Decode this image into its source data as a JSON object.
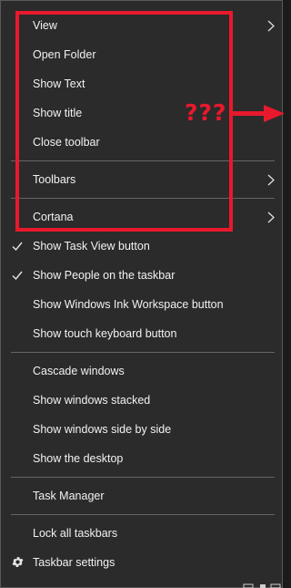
{
  "menu": {
    "view": "View",
    "open_folder": "Open Folder",
    "show_text": "Show Text",
    "show_title": "Show title",
    "close_toolbar": "Close toolbar",
    "toolbars": "Toolbars",
    "cortana": "Cortana",
    "show_task_view": "Show Task View button",
    "show_people": "Show People on the taskbar",
    "show_ink": "Show Windows Ink Workspace button",
    "show_touch_keyboard": "Show touch keyboard button",
    "cascade": "Cascade windows",
    "stacked": "Show windows stacked",
    "side_by_side": "Show windows side by side",
    "show_desktop": "Show the desktop",
    "task_manager": "Task Manager",
    "lock_taskbars": "Lock all taskbars",
    "taskbar_settings": "Taskbar settings"
  },
  "checked": {
    "show_task_view": true,
    "show_people": true
  },
  "submenu_items": [
    "View",
    "Toolbars",
    "Cortana"
  ],
  "annotation": {
    "text": "???",
    "color": "#e8192c"
  },
  "colors": {
    "menu_bg": "#2b2b2b",
    "text": "#f2f2f2",
    "separator": "#656565"
  },
  "icons": {
    "submenu": "chevron-right-icon",
    "checked": "checkmark-icon",
    "settings": "gear-icon"
  }
}
